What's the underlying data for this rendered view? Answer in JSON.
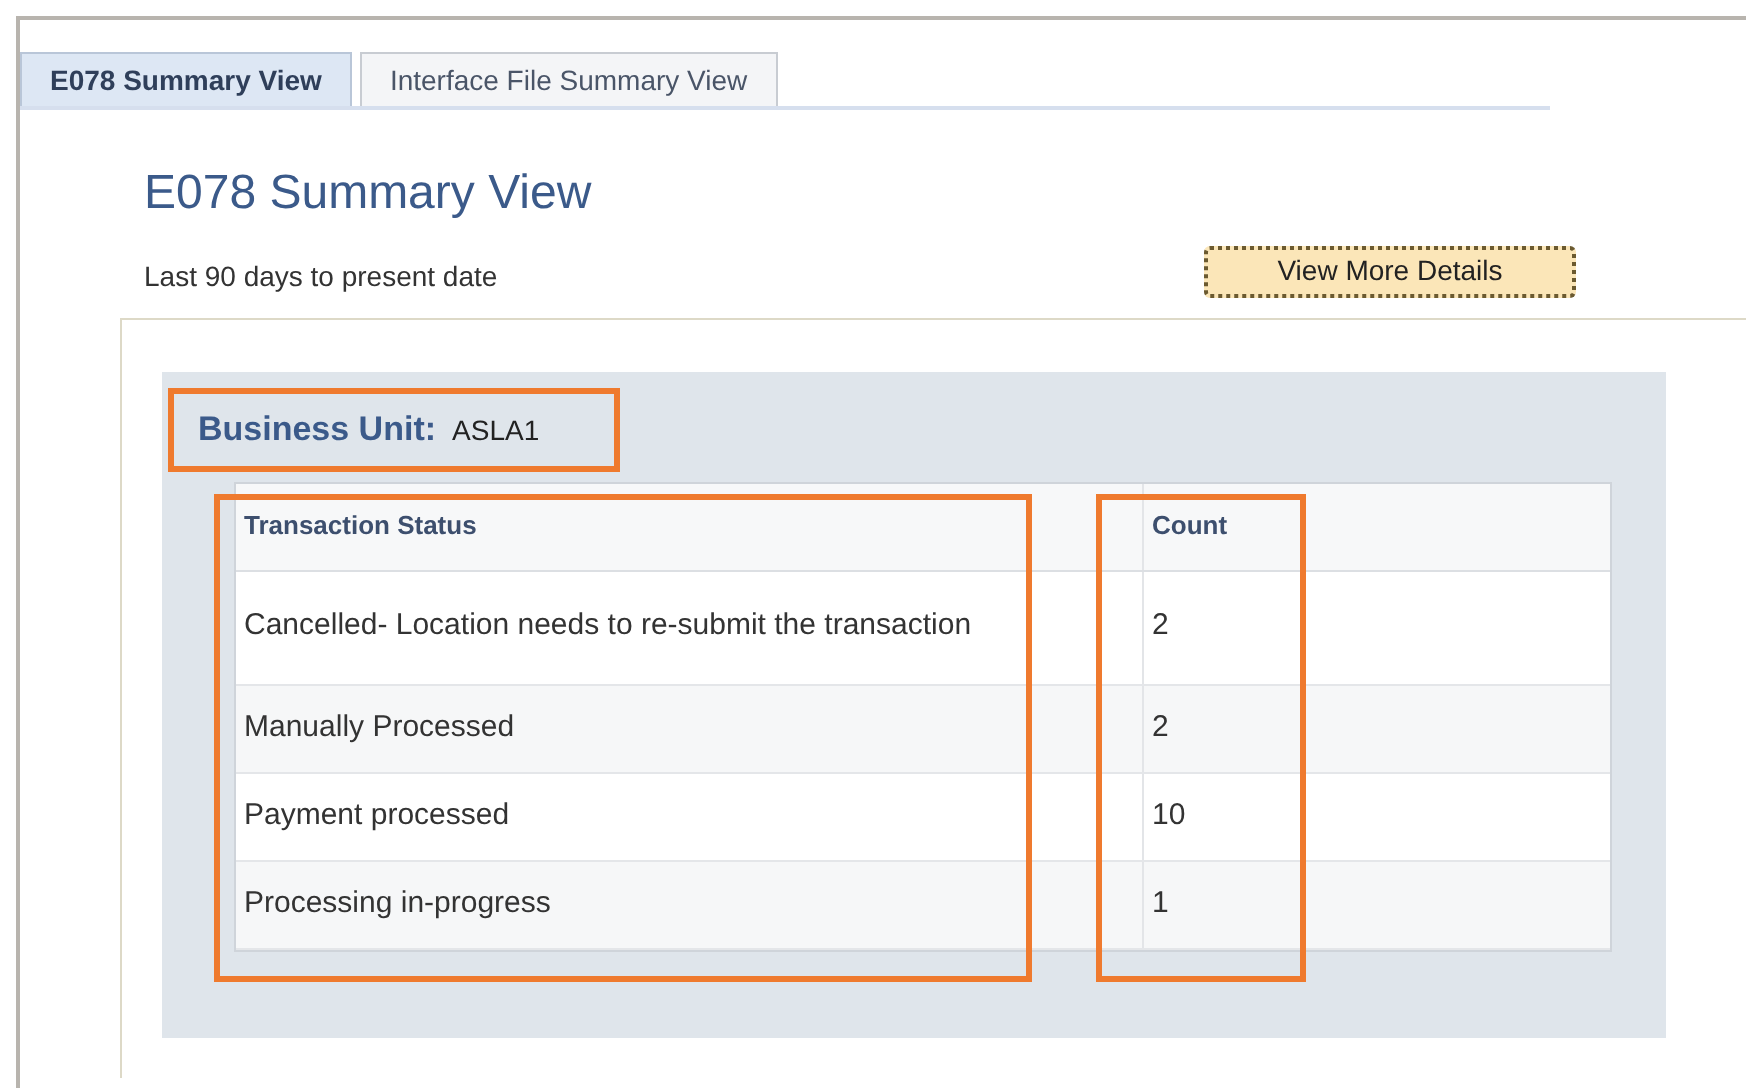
{
  "tabs": [
    {
      "label": "E078 Summary View",
      "selected": true
    },
    {
      "label": "Interface File Summary View",
      "selected": false
    }
  ],
  "page_title": "E078 Summary View",
  "subtitle": "Last 90 days to present date",
  "details_button": "View More Details",
  "business_unit": {
    "label": "Business Unit:",
    "value": "ASLA1"
  },
  "table": {
    "columns": [
      "Transaction Status",
      "Count"
    ],
    "rows": [
      [
        "Cancelled- Location needs to re-submit the transaction",
        "2"
      ],
      [
        "Manually Processed",
        "2"
      ],
      [
        "Payment processed",
        "10"
      ],
      [
        "Processing in-progress",
        "1"
      ]
    ]
  }
}
